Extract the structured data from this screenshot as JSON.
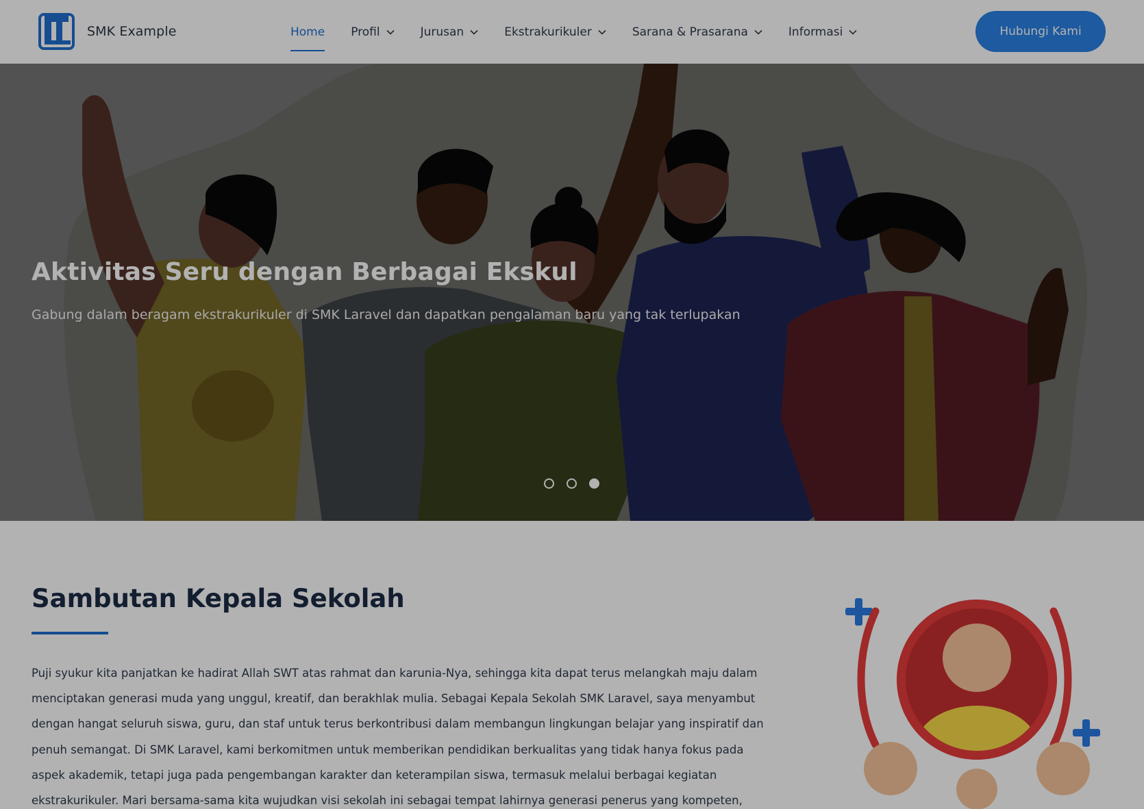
{
  "brand": {
    "name": "SMK Example",
    "logo_icon": "smk-logo-icon"
  },
  "nav": {
    "items": [
      {
        "label": "Home",
        "active": true
      },
      {
        "label": "Profil",
        "dropdown": true
      },
      {
        "label": "Jurusan",
        "dropdown": true
      },
      {
        "label": "Ekstrakurikuler",
        "dropdown": true
      },
      {
        "label": "Sarana & Prasarana",
        "dropdown": true
      },
      {
        "label": "Informasi",
        "dropdown": true
      }
    ],
    "cta_label": "Hubungi Kami"
  },
  "hero": {
    "title": "Aktivitas Seru dengan Berbagai Ekskul",
    "subtitle": "Gabung dalam beragam ekstrakurikuler di SMK Laravel dan dapatkan pengalaman baru yang tak terlupakan",
    "slide_count": 3,
    "active_slide": 3
  },
  "welcome": {
    "title": "Sambutan Kepala Sekolah",
    "paragraph": "Puji syukur kita panjatkan ke hadirat Allah SWT atas rahmat dan karunia-Nya, sehingga kita dapat terus melangkah maju dalam menciptakan generasi muda yang unggul, kreatif, dan berakhlak mulia. Sebagai Kepala Sekolah SMK Laravel, saya menyambut dengan hangat seluruh siswa, guru, dan staf untuk terus berkontribusi dalam membangun lingkungan belajar yang inspiratif dan penuh semangat. Di SMK Laravel, kami berkomitmen untuk memberikan pendidikan berkualitas yang tidak hanya fokus pada aspek akademik, tetapi juga pada pengembangan karakter dan keterampilan siswa, termasuk melalui berbagai kegiatan ekstrakurikuler. Mari bersama-sama kita wujudkan visi sekolah ini sebagai tempat lahirnya generasi penerus yang kompeten, berdaya saing, dan"
  },
  "colors": {
    "primary": "#1f6fcf",
    "button": "#2a82e4",
    "heading": "#1c2b45"
  }
}
